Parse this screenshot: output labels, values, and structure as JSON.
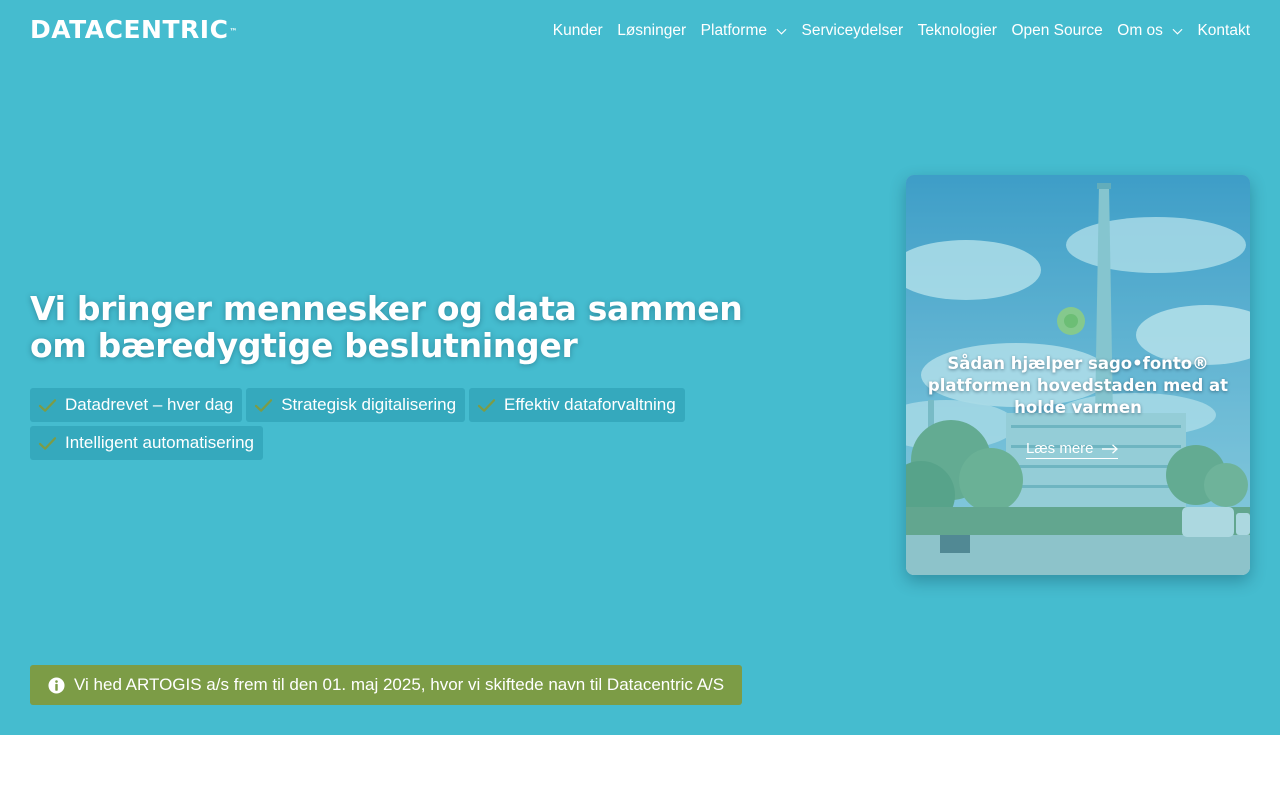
{
  "brand": {
    "name": "DATACENTRIC",
    "trademark": "™"
  },
  "nav": {
    "items": [
      {
        "label": "Kunder",
        "dropdown": false
      },
      {
        "label": "Løsninger",
        "dropdown": false
      },
      {
        "label": "Platforme",
        "dropdown": true
      },
      {
        "label": "Serviceydelser",
        "dropdown": false
      },
      {
        "label": "Teknologier",
        "dropdown": false
      },
      {
        "label": "Open Source",
        "dropdown": false
      },
      {
        "label": "Om os",
        "dropdown": true
      },
      {
        "label": "Kontakt",
        "dropdown": false
      }
    ]
  },
  "hero": {
    "headline": "Vi bringer mennesker og data sammen om bæredygtige beslutninger",
    "tags": [
      "Datadrevet – hver dag",
      "Strategisk digitalisering",
      "Effektiv dataforvaltning",
      "Intelligent automatisering"
    ]
  },
  "card": {
    "title": "Sådan hjælper sago•fonto® platformen hovedstaden med at holde varmen",
    "link_label": "Læs mere"
  },
  "notice": {
    "text": "Vi hed ARTOGIS a/s frem til den 01. maj 2025, hvor vi skiftede navn til Datacentric A/S"
  },
  "colors": {
    "hero_background": "#45bccf",
    "tag_background": "#35a9bd",
    "check_icon": "#7c9c46",
    "notice_background": "#7c9c46",
    "text": "#ffffff"
  }
}
